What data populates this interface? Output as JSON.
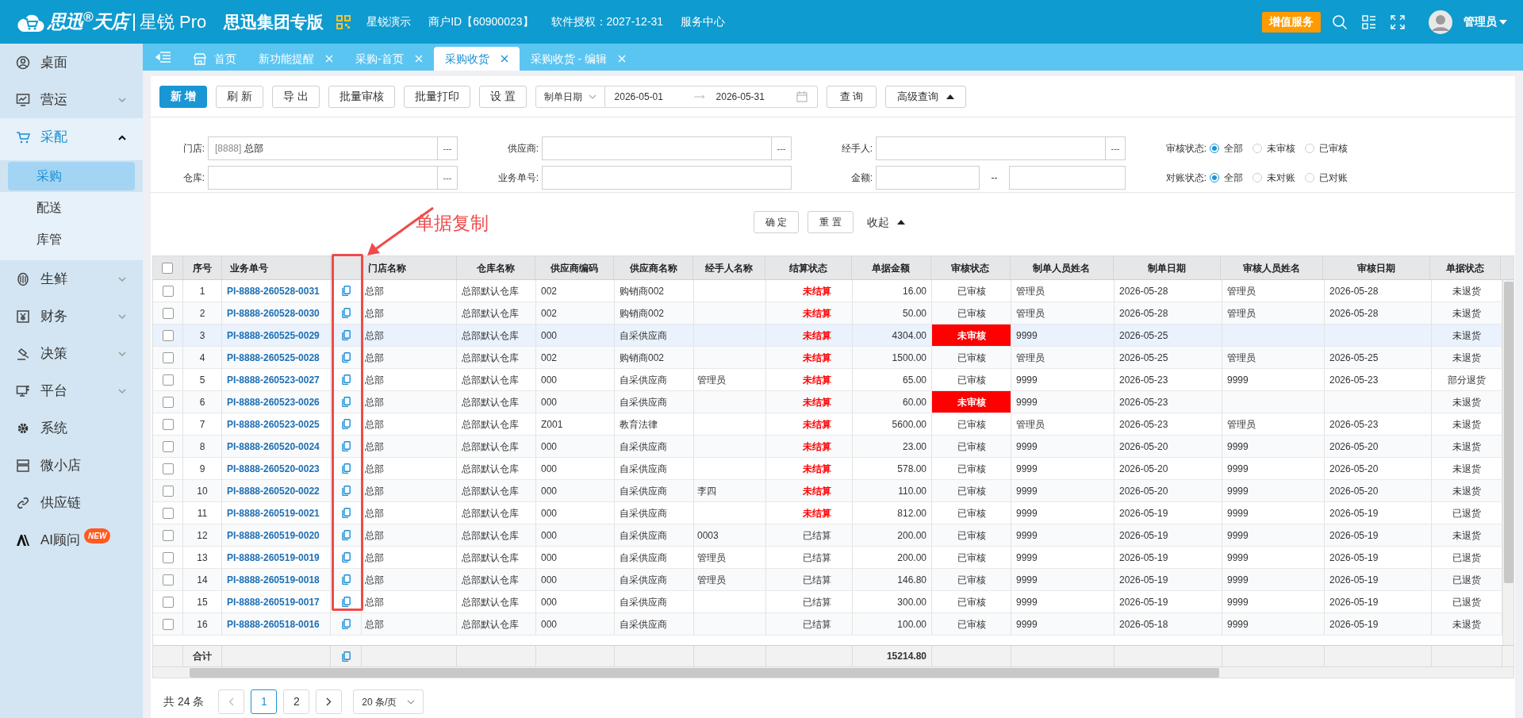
{
  "header": {
    "brand": "思迅$^{®}$天店",
    "product": "星锐 Pro",
    "edition": "思迅集团专版",
    "links": [
      "星锐演示",
      "商户ID【60900023】",
      "软件授权：2027-12-31",
      "服务中心"
    ],
    "promo_button": "增值服务",
    "user": "管理员"
  },
  "sidebar": {
    "items": [
      {
        "label": "桌面",
        "selected": false
      },
      {
        "label": "营运",
        "selected": false,
        "expanded": false
      },
      {
        "label": "采配",
        "selected": true,
        "expanded": true,
        "children": [
          {
            "label": "采购",
            "selected": true
          },
          {
            "label": "配送",
            "selected": false
          },
          {
            "label": "库管",
            "selected": false
          }
        ]
      },
      {
        "label": "生鲜",
        "selected": false,
        "expanded": false
      },
      {
        "label": "财务",
        "selected": false,
        "expanded": false
      },
      {
        "label": "决策",
        "selected": false,
        "expanded": false
      },
      {
        "label": "平台",
        "selected": false,
        "expanded": false
      },
      {
        "label": "系统",
        "selected": false
      },
      {
        "label": "微小店",
        "selected": false
      },
      {
        "label": "供应链",
        "selected": false
      },
      {
        "label": "AI顾问",
        "selected": false,
        "badge": "NEW"
      }
    ]
  },
  "tabs": [
    {
      "kind": "home",
      "label": "首页",
      "selected": false,
      "closable": false
    },
    {
      "kind": "page",
      "label": "新功能提醒",
      "selected": false,
      "closable": true
    },
    {
      "kind": "page",
      "label": "采购-首页",
      "selected": false,
      "closable": true
    },
    {
      "kind": "page",
      "label": "采购收货",
      "selected": true,
      "closable": true
    },
    {
      "kind": "page",
      "label": "采购收货 - 编辑",
      "selected": false,
      "closable": true
    }
  ],
  "toolbar": {
    "buttons": [
      {
        "label": "新 增",
        "primary": true
      },
      {
        "label": "刷 新",
        "primary": false
      },
      {
        "label": "导 出",
        "primary": false
      },
      {
        "label": "批量审核",
        "primary": false
      },
      {
        "label": "批量打印",
        "primary": false
      },
      {
        "label": "设 置",
        "primary": false
      }
    ],
    "date_filter": {
      "type": "制单日期",
      "start": "2026-05-01",
      "end": "2026-05-31"
    },
    "query_button": "查 询",
    "advanced_button": "高级查询"
  },
  "filters": [
    {
      "kind": "picker",
      "label": "门店:",
      "code": "[8888]",
      "value": "总部",
      "button": "---"
    },
    {
      "kind": "picker",
      "label": "供应商:",
      "button": "---"
    },
    {
      "kind": "picker",
      "label": "经手人:",
      "button": "---"
    },
    {
      "kind": "radio",
      "label": "审核状态:",
      "options": [
        {
          "label": "全部",
          "selected": true
        },
        {
          "label": "未审核",
          "selected": false
        },
        {
          "label": "已审核",
          "selected": false
        }
      ]
    },
    {
      "kind": "picker",
      "label": "仓库:",
      "button": "---"
    },
    {
      "kind": "text",
      "label": "业务单号:"
    },
    {
      "kind": "range",
      "label": "金额:",
      "separator": "--"
    },
    {
      "kind": "radio",
      "label": "对账状态:",
      "options": [
        {
          "label": "全部",
          "selected": true
        },
        {
          "label": "未对账",
          "selected": false
        },
        {
          "label": "已对账",
          "selected": false
        }
      ]
    }
  ],
  "filter_actions": {
    "confirm": "确 定",
    "reset": "重 置",
    "collapse": "收起"
  },
  "annotation": {
    "text": "单据复制"
  },
  "table": {
    "columns": [
      "序号",
      "业务单号",
      "门店名称",
      "仓库名称",
      "供应商编码",
      "供应商名称",
      "经手人名称",
      "结算状态",
      "单据金额",
      "审核状态",
      "制单人员姓名",
      "制单日期",
      "审核人员姓名",
      "审核日期",
      "单据状态"
    ],
    "header_checked": false,
    "rows": [
      {
        "checked": false,
        "selected": false,
        "no": "1",
        "doc_no": "PI-8888-260528-0031",
        "store": "总部",
        "warehouse": "总部默认仓库",
        "supplier_code": "002",
        "supplier_name": "购销商002",
        "settlement": "未结算",
        "settled": false,
        "amount": "16.00",
        "audit_status": "已审核",
        "audited": true,
        "maker": "管理员",
        "date": "2026-05-28",
        "auditor": "管理员",
        "audit_date": "2026-05-28",
        "doc_status": "未退货"
      },
      {
        "checked": false,
        "selected": false,
        "no": "2",
        "doc_no": "PI-8888-260528-0030",
        "store": "总部",
        "warehouse": "总部默认仓库",
        "supplier_code": "002",
        "supplier_name": "购销商002",
        "settlement": "未结算",
        "settled": false,
        "amount": "50.00",
        "audit_status": "已审核",
        "audited": true,
        "maker": "管理员",
        "date": "2026-05-28",
        "auditor": "管理员",
        "audit_date": "2026-05-28",
        "doc_status": "未退货"
      },
      {
        "checked": false,
        "selected": true,
        "no": "3",
        "doc_no": "PI-8888-260525-0029",
        "store": "总部",
        "warehouse": "总部默认仓库",
        "supplier_code": "000",
        "supplier_name": "自采供应商",
        "settlement": "未结算",
        "settled": false,
        "amount": "4304.00",
        "audit_status": "未审核",
        "audited": false,
        "maker": "9999",
        "date": "2026-05-25",
        "doc_status": "未退货"
      },
      {
        "checked": false,
        "selected": false,
        "no": "4",
        "doc_no": "PI-8888-260525-0028",
        "store": "总部",
        "warehouse": "总部默认仓库",
        "supplier_code": "002",
        "supplier_name": "购销商002",
        "settlement": "未结算",
        "settled": false,
        "amount": "1500.00",
        "audit_status": "已审核",
        "audited": true,
        "maker": "管理员",
        "date": "2026-05-25",
        "auditor": "管理员",
        "audit_date": "2026-05-25",
        "doc_status": "未退货"
      },
      {
        "checked": false,
        "selected": false,
        "no": "5",
        "doc_no": "PI-8888-260523-0027",
        "store": "总部",
        "warehouse": "总部默认仓库",
        "supplier_code": "000",
        "supplier_name": "自采供应商",
        "handler": "管理员",
        "settlement": "未结算",
        "settled": false,
        "amount": "65.00",
        "audit_status": "已审核",
        "audited": true,
        "maker": "9999",
        "date": "2026-05-23",
        "auditor": "9999",
        "audit_date": "2026-05-23",
        "doc_status": "部分退货"
      },
      {
        "checked": false,
        "selected": false,
        "no": "6",
        "doc_no": "PI-8888-260523-0026",
        "store": "总部",
        "warehouse": "总部默认仓库",
        "supplier_code": "000",
        "supplier_name": "自采供应商",
        "settlement": "未结算",
        "settled": false,
        "amount": "60.00",
        "audit_status": "未审核",
        "audited": false,
        "maker": "9999",
        "date": "2026-05-23",
        "doc_status": "未退货"
      },
      {
        "checked": false,
        "selected": false,
        "no": "7",
        "doc_no": "PI-8888-260523-0025",
        "store": "总部",
        "warehouse": "总部默认仓库",
        "supplier_code": "Z001",
        "supplier_name": "教育法律",
        "settlement": "未结算",
        "settled": false,
        "amount": "5600.00",
        "audit_status": "已审核",
        "audited": true,
        "maker": "管理员",
        "date": "2026-05-23",
        "auditor": "管理员",
        "audit_date": "2026-05-23",
        "doc_status": "未退货"
      },
      {
        "checked": false,
        "selected": false,
        "no": "8",
        "doc_no": "PI-8888-260520-0024",
        "store": "总部",
        "warehouse": "总部默认仓库",
        "supplier_code": "000",
        "supplier_name": "自采供应商",
        "settlement": "未结算",
        "settled": false,
        "amount": "23.00",
        "audit_status": "已审核",
        "audited": true,
        "maker": "9999",
        "date": "2026-05-20",
        "auditor": "9999",
        "audit_date": "2026-05-20",
        "doc_status": "未退货"
      },
      {
        "checked": false,
        "selected": false,
        "no": "9",
        "doc_no": "PI-8888-260520-0023",
        "store": "总部",
        "warehouse": "总部默认仓库",
        "supplier_code": "000",
        "supplier_name": "自采供应商",
        "settlement": "未结算",
        "settled": false,
        "amount": "578.00",
        "audit_status": "已审核",
        "audited": true,
        "maker": "9999",
        "date": "2026-05-20",
        "auditor": "9999",
        "audit_date": "2026-05-20",
        "doc_status": "未退货"
      },
      {
        "checked": false,
        "selected": false,
        "no": "10",
        "doc_no": "PI-8888-260520-0022",
        "store": "总部",
        "warehouse": "总部默认仓库",
        "supplier_code": "000",
        "supplier_name": "自采供应商",
        "handler": "李四",
        "settlement": "未结算",
        "settled": false,
        "amount": "110.00",
        "audit_status": "已审核",
        "audited": true,
        "maker": "9999",
        "date": "2026-05-20",
        "auditor": "9999",
        "audit_date": "2026-05-20",
        "doc_status": "未退货"
      },
      {
        "checked": false,
        "selected": false,
        "no": "11",
        "doc_no": "PI-8888-260519-0021",
        "store": "总部",
        "warehouse": "总部默认仓库",
        "supplier_code": "000",
        "supplier_name": "自采供应商",
        "settlement": "未结算",
        "settled": false,
        "amount": "812.00",
        "audit_status": "已审核",
        "audited": true,
        "maker": "9999",
        "date": "2026-05-19",
        "auditor": "9999",
        "audit_date": "2026-05-19",
        "doc_status": "已退货"
      },
      {
        "checked": false,
        "selected": false,
        "no": "12",
        "doc_no": "PI-8888-260519-0020",
        "store": "总部",
        "warehouse": "总部默认仓库",
        "supplier_code": "000",
        "supplier_name": "自采供应商",
        "handler": "0003",
        "settlement": "已结算",
        "settled": true,
        "amount": "200.00",
        "audit_status": "已审核",
        "audited": true,
        "maker": "9999",
        "date": "2026-05-19",
        "auditor": "9999",
        "audit_date": "2026-05-19",
        "doc_status": "未退货"
      },
      {
        "checked": false,
        "selected": false,
        "no": "13",
        "doc_no": "PI-8888-260519-0019",
        "store": "总部",
        "warehouse": "总部默认仓库",
        "supplier_code": "000",
        "supplier_name": "自采供应商",
        "handler": "管理员",
        "settlement": "已结算",
        "settled": true,
        "amount": "200.00",
        "audit_status": "已审核",
        "audited": true,
        "maker": "9999",
        "date": "2026-05-19",
        "auditor": "9999",
        "audit_date": "2026-05-19",
        "doc_status": "已退货"
      },
      {
        "checked": false,
        "selected": false,
        "no": "14",
        "doc_no": "PI-8888-260519-0018",
        "store": "总部",
        "warehouse": "总部默认仓库",
        "supplier_code": "000",
        "supplier_name": "自采供应商",
        "handler": "管理员",
        "settlement": "已结算",
        "settled": true,
        "amount": "146.80",
        "audit_status": "已审核",
        "audited": true,
        "maker": "9999",
        "date": "2026-05-19",
        "auditor": "9999",
        "audit_date": "2026-05-19",
        "doc_status": "已退货"
      },
      {
        "checked": false,
        "selected": false,
        "no": "15",
        "doc_no": "PI-8888-260519-0017",
        "store": "总部",
        "warehouse": "总部默认仓库",
        "supplier_code": "000",
        "supplier_name": "自采供应商",
        "settlement": "已结算",
        "settled": true,
        "amount": "300.00",
        "audit_status": "已审核",
        "audited": true,
        "maker": "9999",
        "date": "2026-05-19",
        "auditor": "9999",
        "audit_date": "2026-05-19",
        "doc_status": "已退货"
      },
      {
        "checked": false,
        "selected": false,
        "no": "16",
        "doc_no": "PI-8888-260518-0016",
        "store": "总部",
        "warehouse": "总部默认仓库",
        "supplier_code": "000",
        "supplier_name": "自采供应商",
        "settlement": "已结算",
        "settled": true,
        "amount": "100.00",
        "audit_status": "已审核",
        "audited": true,
        "maker": "9999",
        "date": "2026-05-18",
        "auditor": "9999",
        "audit_date": "2026-05-19",
        "doc_status": "未退货"
      }
    ],
    "total": {
      "label": "合计",
      "amount": "15214.80"
    }
  },
  "pagination": {
    "total": "共 24 条",
    "pages": [
      {
        "label": "1",
        "selected": true
      },
      {
        "label": "2",
        "selected": false
      }
    ],
    "page_size": "20 条/页"
  }
}
